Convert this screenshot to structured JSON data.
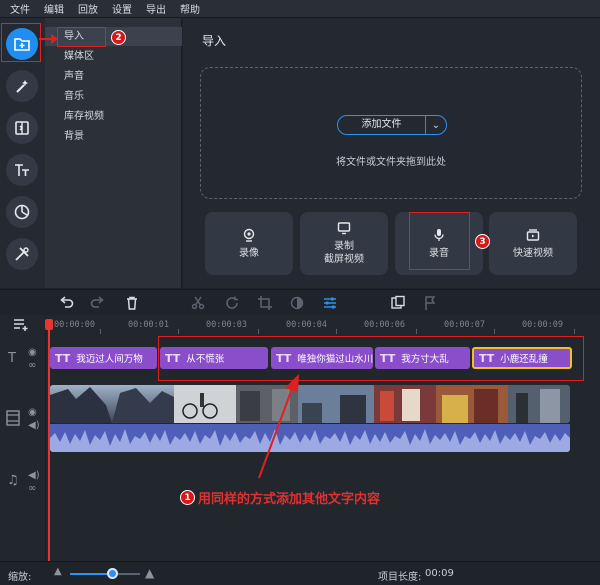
{
  "menu": [
    "文件",
    "编辑",
    "回放",
    "设置",
    "导出",
    "帮助"
  ],
  "categories": [
    "导入",
    "媒体区",
    "声音",
    "音乐",
    "库存视频",
    "背景"
  ],
  "panel": {
    "title": "导入",
    "add_file_label": "添加文件",
    "add_file_arrow": "⌄",
    "drop_hint": "将文件或文件夹拖到此处",
    "record_buttons": [
      {
        "label": "录像",
        "icon": "webcam-icon"
      },
      {
        "label": "录制\n截屏视频",
        "icon": "screen-record-icon"
      },
      {
        "label": "录音",
        "icon": "microphone-icon"
      },
      {
        "label": "快速视频",
        "icon": "quick-video-icon"
      }
    ]
  },
  "annotations": {
    "badge_1": "1",
    "badge_2": "2",
    "badge_3": "3",
    "note": "用同样的方式添加其他文字内容"
  },
  "timeline": {
    "ruler": [
      "00:00:00",
      "00:00:01",
      "00:00:03",
      "00:00:04",
      "00:00:06",
      "00:00:07",
      "00:00:09"
    ],
    "title_glyph": "TT",
    "title_clips": [
      {
        "text": "我迈过人间万物"
      },
      {
        "text": "从不慌张"
      },
      {
        "text": "唯独你猫过山水川"
      },
      {
        "text": "我方寸大乱"
      },
      {
        "text": "小鹿还乱撞"
      }
    ]
  },
  "status": {
    "zoom_label": "缩放:",
    "zoom_level": 0.6,
    "project_length_label": "项目长度:",
    "project_length_value": "00:09"
  },
  "colors": {
    "accent": "#2c91f0",
    "title_clip": "#8a4ecb",
    "annotation_red": "#e02020",
    "selected_outline": "#f1c21b"
  }
}
